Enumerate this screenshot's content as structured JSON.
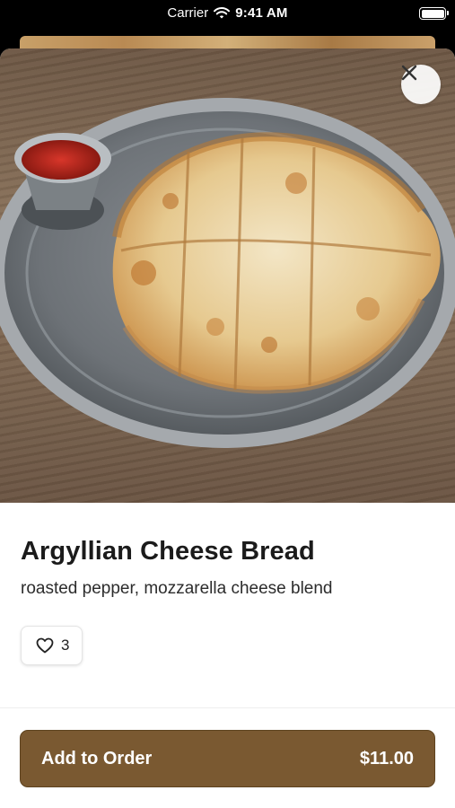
{
  "status_bar": {
    "carrier": "Carrier",
    "time": "9:41 AM"
  },
  "item": {
    "title": "Argyllian Cheese Bread",
    "description": "roasted pepper, mozzarella cheese blend",
    "likes": "3",
    "image_icon": "cheese-bread-photo"
  },
  "footer": {
    "add_label": "Add to Order",
    "price": "$11.00"
  },
  "colors": {
    "accent": "#7a5931",
    "text": "#1b1b1b"
  }
}
